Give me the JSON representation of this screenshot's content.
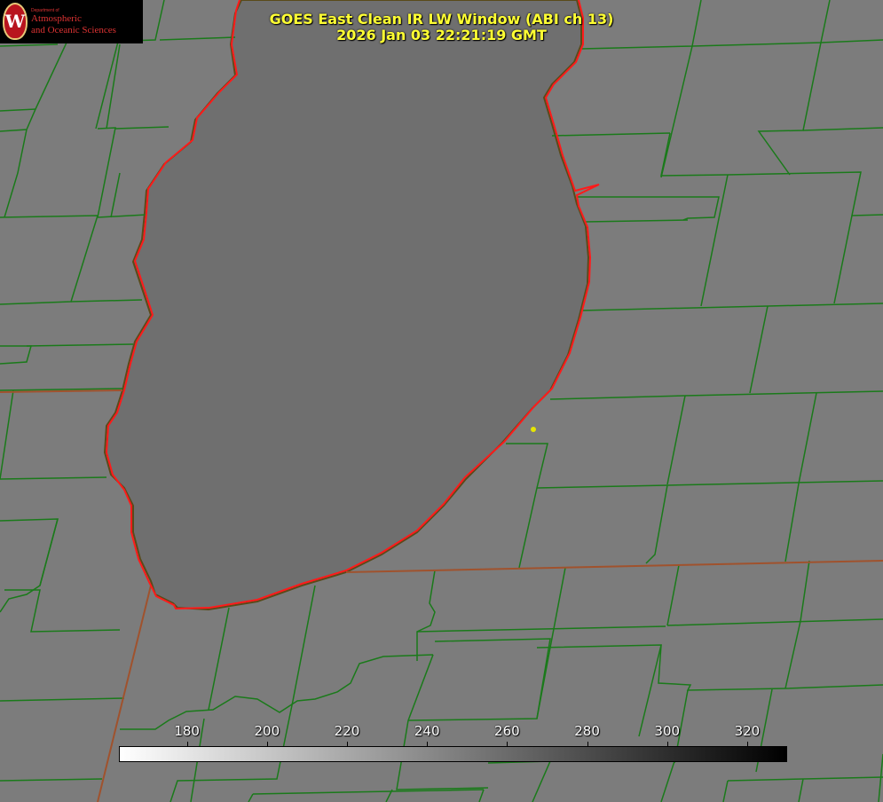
{
  "title": {
    "line1": "GOES East Clean IR LW Window (ABI ch 13)",
    "line2": "2026 Jan 03 22:21:19 GMT"
  },
  "logo": {
    "small_text": "Department of",
    "line1": "Atmospheric",
    "line2": "and Oceanic Sciences",
    "crest_letter": "W"
  },
  "colorbar": {
    "labels": [
      "180",
      "200",
      "220",
      "240",
      "260",
      "280",
      "300",
      "320"
    ],
    "range": [
      163,
      330
    ],
    "gradient": [
      "#ffffff",
      "#000000"
    ]
  },
  "colors": {
    "background": "#7a7a7a",
    "lake": "#6f6f6f",
    "county_lines": "#1a7a1a",
    "state_lines": "#a0522d",
    "shoreline": "#ff1a1a",
    "title_text": "#ffff33",
    "marker": "#e6e600"
  }
}
